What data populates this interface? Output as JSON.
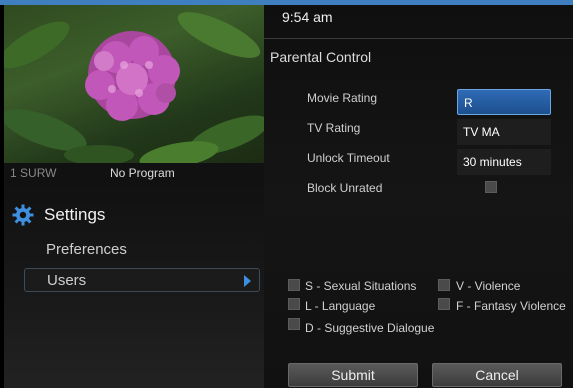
{
  "clock": "9:54 am",
  "channel": {
    "number": "1",
    "name": "SURW",
    "program": "No Program"
  },
  "settings": {
    "title": "Settings",
    "items": [
      {
        "label": "Preferences",
        "selected": false
      },
      {
        "label": "Users",
        "selected": true
      }
    ]
  },
  "parental": {
    "title": "Parental Control",
    "rows": [
      {
        "label": "Movie Rating",
        "value": "R",
        "selected": true
      },
      {
        "label": "TV Rating",
        "value": "TV MA",
        "selected": false
      },
      {
        "label": "Unlock Timeout",
        "value": "30 minutes",
        "selected": false
      }
    ],
    "block_unrated": {
      "label": "Block Unrated",
      "checked": false
    },
    "content_filters": [
      {
        "label": "S - Sexual Situations",
        "checked": false
      },
      {
        "label": "V - Violence",
        "checked": false
      },
      {
        "label": "L - Language",
        "checked": false
      },
      {
        "label": "F - Fantasy Violence",
        "checked": false
      },
      {
        "label": "D - Suggestive Dialogue",
        "checked": false
      }
    ]
  },
  "buttons": {
    "submit": "Submit",
    "cancel": "Cancel"
  },
  "colors": {
    "accent": "#3f7fc0",
    "selected_field": "#2f6bb5"
  }
}
